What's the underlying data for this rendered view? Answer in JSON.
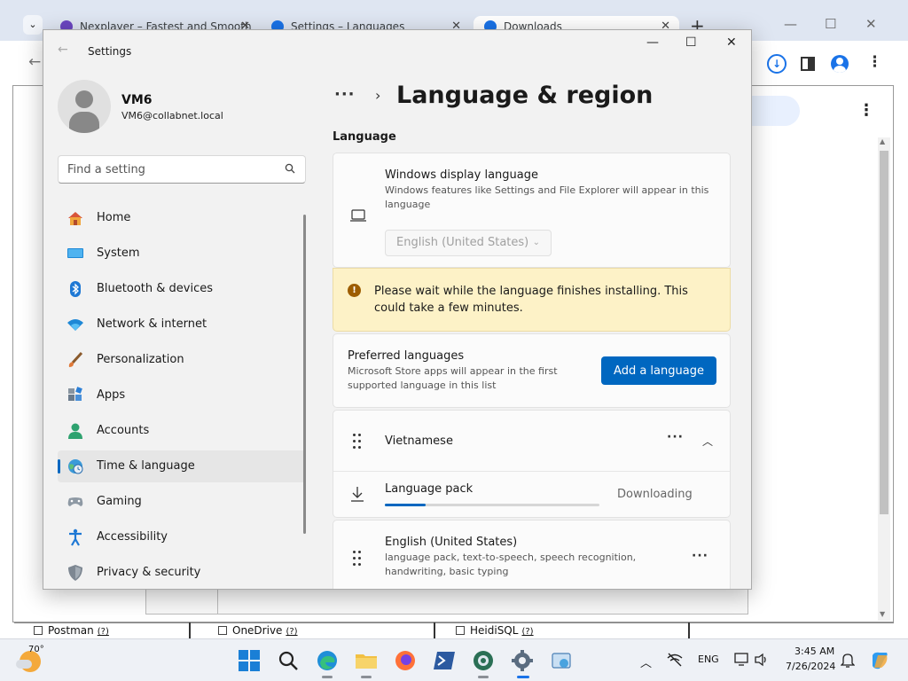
{
  "browser": {
    "tabs": [
      {
        "title": "Nexplayer – Fastest and Smooth"
      },
      {
        "title": "Settings – Languages"
      },
      {
        "title": "Downloads"
      }
    ],
    "bottom_items": [
      {
        "label": "Postman",
        "q": "(?)"
      },
      {
        "label": "OneDrive",
        "q": "(?)"
      },
      {
        "label": "HeidiSQL",
        "q": "(?)"
      }
    ]
  },
  "settings": {
    "window_title": "Settings",
    "user": {
      "name": "VM6",
      "email": "VM6@collabnet.local"
    },
    "search": {
      "placeholder": "Find a setting"
    },
    "nav": [
      {
        "label": "Home",
        "icon": "home-icon"
      },
      {
        "label": "System",
        "icon": "system-icon"
      },
      {
        "label": "Bluetooth & devices",
        "icon": "bluetooth-icon"
      },
      {
        "label": "Network & internet",
        "icon": "wifi-icon"
      },
      {
        "label": "Personalization",
        "icon": "brush-icon"
      },
      {
        "label": "Apps",
        "icon": "apps-icon"
      },
      {
        "label": "Accounts",
        "icon": "accounts-icon"
      },
      {
        "label": "Time & language",
        "icon": "globe-clock-icon",
        "selected": true
      },
      {
        "label": "Gaming",
        "icon": "gamepad-icon"
      },
      {
        "label": "Accessibility",
        "icon": "accessibility-icon"
      },
      {
        "label": "Privacy & security",
        "icon": "shield-icon"
      }
    ],
    "breadcrumb": {
      "ellipsis": "···",
      "separator": "›"
    },
    "page_title": "Language & region",
    "section_label": "Language",
    "display_language": {
      "title": "Windows display language",
      "description": "Windows features like Settings and File Explorer will appear in this language",
      "selected_value": "English (United States)"
    },
    "warning": {
      "text": "Please wait while the language finishes installing. This could take a few minutes."
    },
    "preferred": {
      "title": "Preferred languages",
      "description": "Microsoft Store apps will appear in the first supported language in this list",
      "add_button": "Add a language"
    },
    "languages": [
      {
        "name": "Vietnamese",
        "pack_label": "Language pack",
        "status": "Downloading",
        "progress": 0.19
      },
      {
        "name": "English (United States)",
        "description": "language pack, text-to-speech, speech recognition, handwriting, basic typing"
      }
    ]
  },
  "taskbar": {
    "weather": "70°",
    "language": "ENG",
    "time": "3:45 AM",
    "date": "7/26/2024"
  },
  "colors": {
    "accent": "#0067c0",
    "warning_bg": "#fdf2c7",
    "warning_icon": "#9d5d00"
  }
}
